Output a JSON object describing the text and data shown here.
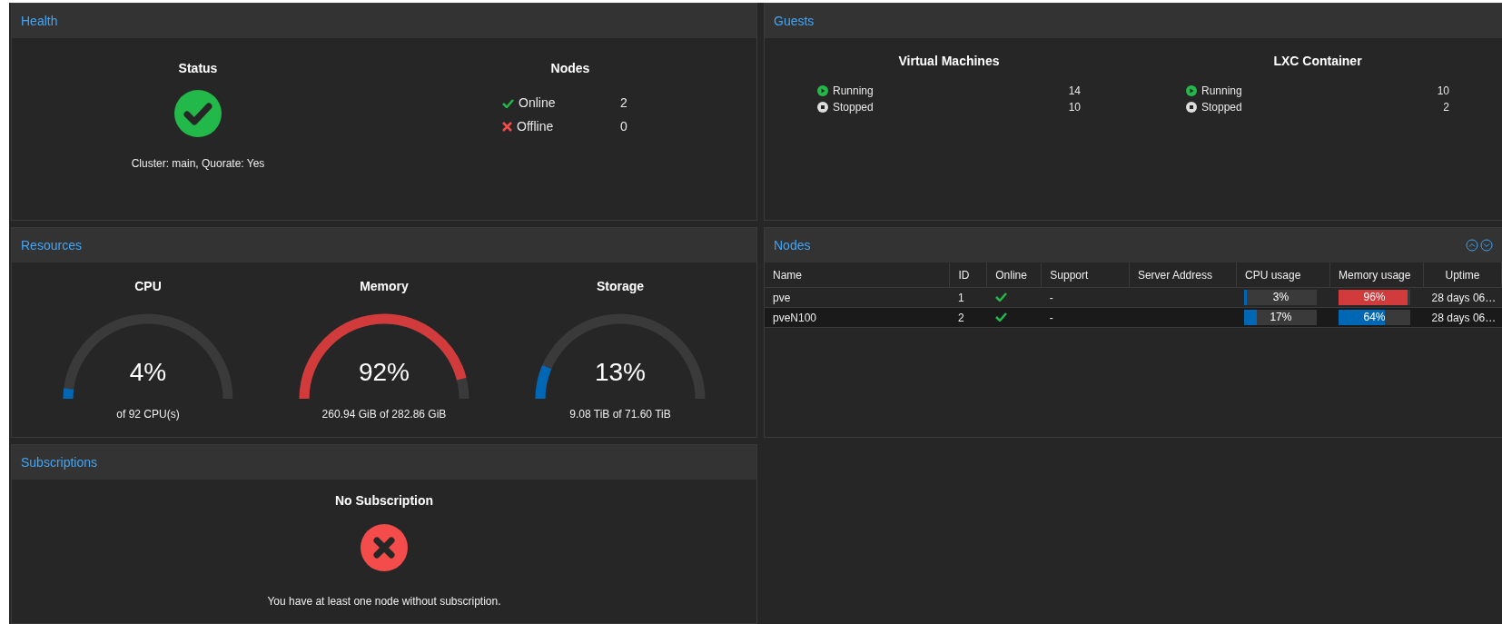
{
  "health": {
    "title": "Health",
    "status": {
      "heading": "Status",
      "ok": true,
      "text": "Cluster: main, Quorate: Yes"
    },
    "nodes": {
      "heading": "Nodes",
      "items": [
        {
          "kind": "online",
          "label": "Online",
          "count": "2"
        },
        {
          "kind": "offline",
          "label": "Offline",
          "count": "0"
        }
      ]
    }
  },
  "guests": {
    "title": "Guests",
    "groups": [
      {
        "heading": "Virtual Machines",
        "items": [
          {
            "kind": "running",
            "label": "Running",
            "count": "14"
          },
          {
            "kind": "stopped",
            "label": "Stopped",
            "count": "10"
          }
        ]
      },
      {
        "heading": "LXC Container",
        "items": [
          {
            "kind": "running",
            "label": "Running",
            "count": "10"
          },
          {
            "kind": "stopped",
            "label": "Stopped",
            "count": "2"
          }
        ]
      }
    ]
  },
  "resources": {
    "title": "Resources",
    "gauges": [
      {
        "label": "CPU",
        "reading": "4%",
        "warning": false,
        "detail": "of 92 CPU(s)"
      },
      {
        "label": "Memory",
        "reading": "92%",
        "warning": true,
        "detail": "260.94 GiB of 282.86 GiB"
      },
      {
        "label": "Storage",
        "reading": "13%",
        "warning": false,
        "detail": "9.08 TiB of 71.60 TiB"
      }
    ]
  },
  "nodes_panel": {
    "title": "Nodes",
    "columns": [
      "Name",
      "ID",
      "Online",
      "Support",
      "Server Address",
      "CPU usage",
      "Memory usage",
      "Uptime"
    ],
    "rows": [
      {
        "name": "pve",
        "id": "1",
        "online": true,
        "support": "-",
        "cpu": {
          "reading": "3%",
          "level": 0.03,
          "color": "#0067b5"
        },
        "memory": {
          "reading": "96%",
          "level": 0.96,
          "color": "#d13b3b"
        },
        "uptime": "28 days 06…",
        "selected": false
      },
      {
        "name": "pveN100",
        "id": "2",
        "online": true,
        "support": "-",
        "cpu": {
          "reading": "17%",
          "level": 0.17,
          "color": "#0067b5"
        },
        "memory": {
          "reading": "64%",
          "level": 0.64,
          "color": "#0067b5"
        },
        "uptime": "28 days 06…",
        "selected": true
      }
    ]
  },
  "subscriptions": {
    "title": "Subscriptions",
    "heading": "No Subscription",
    "ok": false,
    "text": "You have at least one node without subscription."
  }
}
